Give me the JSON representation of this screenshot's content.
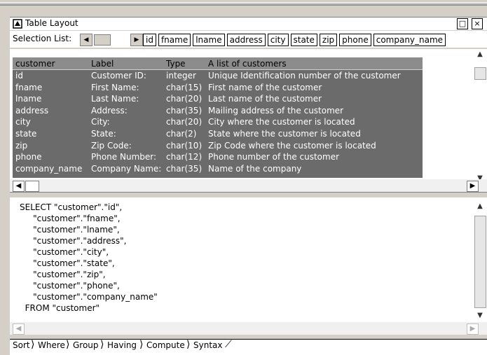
{
  "window": {
    "title": "Table Layout",
    "restore_glyph": "□",
    "close_glyph": "×"
  },
  "selection": {
    "label": "Selection List:",
    "columns": [
      "id",
      "fname",
      "lname",
      "address",
      "city",
      "state",
      "zip",
      "phone",
      "company_name"
    ]
  },
  "grid": {
    "headers": [
      "customer",
      "Label",
      "Type",
      "A list of customers"
    ],
    "rows": [
      [
        "id",
        "Customer ID:",
        "integer",
        "Unique Identification number of the customer"
      ],
      [
        "fname",
        "First Name:",
        "char(15)",
        "First name of the customer"
      ],
      [
        "lname",
        "Last Name:",
        "char(20)",
        "Last name of the customer"
      ],
      [
        "address",
        "Address:",
        "char(35)",
        "Mailing address of the customer"
      ],
      [
        "city",
        "City:",
        "char(20)",
        "City where the customer is located"
      ],
      [
        "state",
        "State:",
        "char(2)",
        "State where the customer is located"
      ],
      [
        "zip",
        "Zip Code:",
        "char(10)",
        "Zip Code where the customer is located"
      ],
      [
        "phone",
        "Phone Number:",
        "char(12)",
        "Phone number of the customer"
      ],
      [
        "company_name",
        "Company Name:",
        "char(35)",
        "Name of the company"
      ]
    ]
  },
  "sql": {
    "text": "SELECT \"customer\".\"id\",\n     \"customer\".\"fname\",\n     \"customer\".\"lname\",\n     \"customer\".\"address\",\n     \"customer\".\"city\",\n     \"customer\".\"state\",\n     \"customer\".\"zip\",\n     \"customer\".\"phone\",\n     \"customer\".\"company_name\"\n  FROM \"customer\""
  },
  "tabs": [
    "Sort",
    "Where",
    "Group",
    "Having",
    "Compute",
    "Syntax"
  ],
  "icons": {
    "window": "table-layout-icon",
    "scroll_left": "◀",
    "scroll_right": "▶",
    "scroll_up": "▲",
    "scroll_down": "▼"
  }
}
